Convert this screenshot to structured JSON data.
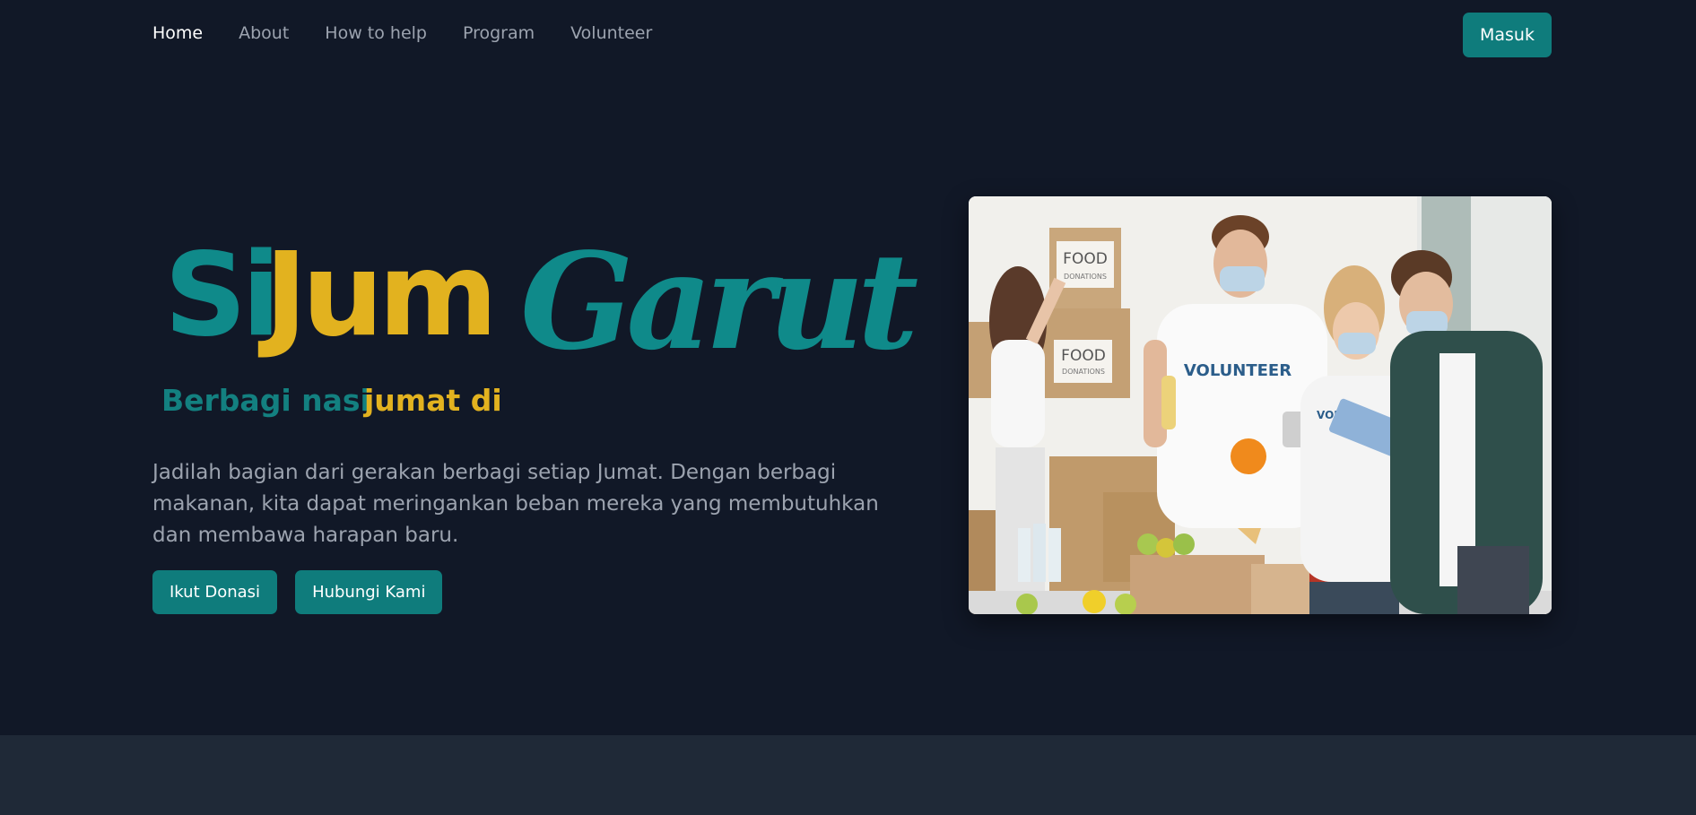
{
  "nav": {
    "links": [
      "Home",
      "About",
      "How to help",
      "Program",
      "Volunteer"
    ],
    "login_label": "Masuk"
  },
  "hero": {
    "logo": {
      "part_si": "Si",
      "part_jum": "Jum",
      "part_garut": "Garut",
      "tagline_a": "Berbagi nasi",
      "tagline_b": "jumat di"
    },
    "description": "Jadilah bagian dari gerakan berbagi setiap Jumat. Dengan berbagi makanan, kita dapat meringankan beban mereka yang membutuhkan dan membawa harapan baru.",
    "buttons": {
      "donate": "Ikut Donasi",
      "contact": "Hubungi Kami"
    },
    "image": {
      "box_top_text": "FOOD",
      "box_top_sub": "DONATIONS",
      "box_mid_text": "FOOD",
      "box_mid_sub": "DONATIONS",
      "shirt_text": "VOLUNTEER",
      "shirt_text_small": "VOL"
    }
  },
  "colors": {
    "background": "#111827",
    "accent": "#0f7c7c",
    "teal_logo": "#0f8a8a",
    "gold_logo": "#e2b21f",
    "muted_text": "#9ca3af",
    "band": "#1f2937"
  }
}
